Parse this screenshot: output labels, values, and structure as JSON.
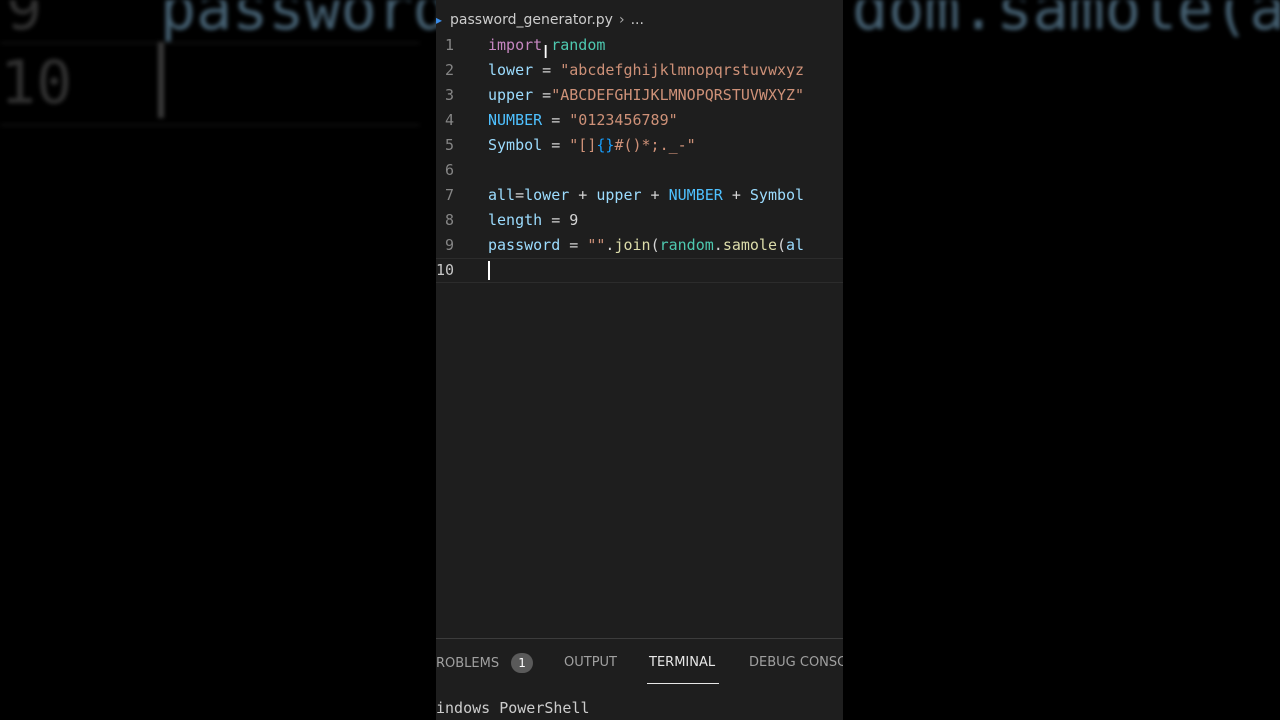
{
  "background": {
    "left_line_numbers": [
      "9",
      "10"
    ],
    "top_code_fragment_left": "password",
    "top_code_fragment_right": "dom.samole(al"
  },
  "editor": {
    "breadcrumb": {
      "file": "password_generator.py",
      "rest": "..."
    },
    "lines": [
      {
        "num": "1",
        "tokens": [
          {
            "t": "import",
            "c": "kw"
          },
          {
            "t": " ",
            "c": ""
          },
          {
            "t": "random",
            "c": "mod"
          }
        ]
      },
      {
        "num": "2",
        "tokens": [
          {
            "t": "lower",
            "c": "var"
          },
          {
            "t": " = ",
            "c": ""
          },
          {
            "t": "\"abcdefghijklmnopqrstuvwxyz",
            "c": "str"
          }
        ]
      },
      {
        "num": "3",
        "tokens": [
          {
            "t": "upper",
            "c": "var"
          },
          {
            "t": " =",
            "c": ""
          },
          {
            "t": "\"ABCDEFGHIJKLMNOPQRSTUVWXYZ\"",
            "c": "str"
          }
        ]
      },
      {
        "num": "4",
        "tokens": [
          {
            "t": "NUMBER",
            "c": "const"
          },
          {
            "t": " = ",
            "c": ""
          },
          {
            "t": "\"0123456789\"",
            "c": "str"
          }
        ]
      },
      {
        "num": "5",
        "tokens": [
          {
            "t": "Symbol",
            "c": "var"
          },
          {
            "t": " = ",
            "c": ""
          },
          {
            "t": "\"[]",
            "c": "str"
          },
          {
            "t": "{}",
            "c": "brace"
          },
          {
            "t": "#()*;._-\"",
            "c": "str"
          }
        ]
      },
      {
        "num": "6",
        "tokens": []
      },
      {
        "num": "7",
        "tokens": [
          {
            "t": "all",
            "c": "var"
          },
          {
            "t": "=",
            "c": ""
          },
          {
            "t": "lower",
            "c": "var"
          },
          {
            "t": " + ",
            "c": ""
          },
          {
            "t": "upper",
            "c": "var"
          },
          {
            "t": " + ",
            "c": ""
          },
          {
            "t": "NUMBER",
            "c": "const"
          },
          {
            "t": " + ",
            "c": ""
          },
          {
            "t": "Symbol",
            "c": "var"
          }
        ]
      },
      {
        "num": "8",
        "tokens": [
          {
            "t": "length",
            "c": "var"
          },
          {
            "t": " = 9",
            "c": ""
          }
        ]
      },
      {
        "num": "9",
        "tokens": [
          {
            "t": "password",
            "c": "var"
          },
          {
            "t": " = ",
            "c": ""
          },
          {
            "t": "\"\"",
            "c": "str"
          },
          {
            "t": ".",
            "c": ""
          },
          {
            "t": "join",
            "c": "fn"
          },
          {
            "t": "(",
            "c": ""
          },
          {
            "t": "random",
            "c": "mod"
          },
          {
            "t": ".",
            "c": ""
          },
          {
            "t": "samole",
            "c": "fn"
          },
          {
            "t": "(",
            "c": ""
          },
          {
            "t": "al",
            "c": "var"
          }
        ]
      },
      {
        "num": "10",
        "tokens": [],
        "current": true
      }
    ]
  },
  "panel": {
    "tabs": [
      {
        "label": "ROBLEMS",
        "badge": "1",
        "active": false
      },
      {
        "label": "OUTPUT",
        "active": false
      },
      {
        "label": "TERMINAL",
        "active": true
      },
      {
        "label": "DEBUG CONSC",
        "active": false
      }
    ],
    "terminal_text": "indows PowerShell"
  },
  "colors": {
    "editor_bg": "#1e1e1e",
    "keyword": "#c586c0",
    "variable": "#9cdcfe",
    "constant": "#4fc1ff",
    "string": "#ce9178"
  }
}
